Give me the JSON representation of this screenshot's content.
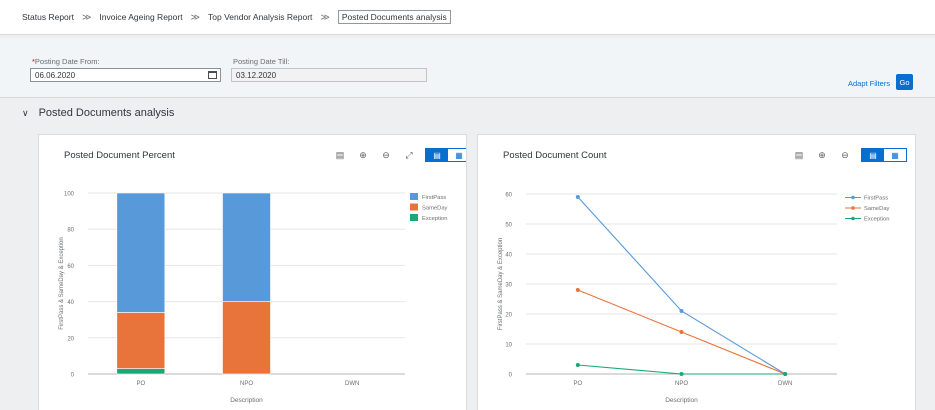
{
  "breadcrumbs": [
    {
      "label": "Status Report"
    },
    {
      "label": "Invoice Ageing Report"
    },
    {
      "label": "Top Vendor Analysis Report"
    },
    {
      "label": "Posted Documents analysis"
    }
  ],
  "breadcrumb_separator": "≫",
  "filters": {
    "from_required_mark": "*",
    "from_label": "Posting Date From:",
    "from_value": "06.06.2020",
    "till_label": "Posting Date Till:",
    "till_value": "03.12.2020",
    "adapt_label": "Adapt Filters",
    "go_label": "Go"
  },
  "section": {
    "chevron": "∨",
    "title": "Posted Documents analysis"
  },
  "panels": {
    "percent_title": "Posted Document Percent",
    "count_title": "Posted Document Count"
  },
  "colors": {
    "firstpass": "#5899da",
    "sameday": "#e8743b",
    "exception": "#19a979",
    "accent": "#0a6ed1"
  },
  "chart_data": [
    {
      "type": "bar",
      "stacked": true,
      "title": "Posted Document Percent",
      "categories": [
        "PO",
        "NPO",
        "DWN"
      ],
      "series": [
        {
          "name": "Exception",
          "values": [
            3,
            0,
            0
          ]
        },
        {
          "name": "SameDay",
          "values": [
            31,
            40,
            0
          ]
        },
        {
          "name": "FirstPass",
          "values": [
            66,
            60,
            0
          ]
        }
      ],
      "legend": [
        "FirstPass",
        "SameDay",
        "Exception"
      ],
      "xlabel": "Description",
      "ylabel": "FirstPass & SameDay & Exception",
      "ylim": [
        0,
        100
      ],
      "yticks": [
        0,
        20,
        40,
        60,
        80,
        100
      ],
      "legend_position": "right",
      "grid": true
    },
    {
      "type": "line",
      "title": "Posted Document Count",
      "categories": [
        "PO",
        "NPO",
        "DWN"
      ],
      "series": [
        {
          "name": "FirstPass",
          "values": [
            59,
            21,
            0
          ]
        },
        {
          "name": "SameDay",
          "values": [
            28,
            14,
            0
          ]
        },
        {
          "name": "Exception",
          "values": [
            3,
            0,
            0
          ]
        }
      ],
      "legend": [
        "FirstPass",
        "SameDay",
        "Exception"
      ],
      "xlabel": "Description",
      "ylabel": "FirstPass & SameDay & Exception",
      "ylim": [
        0,
        60
      ],
      "yticks": [
        0,
        10,
        20,
        30,
        40,
        50,
        60
      ],
      "legend_position": "right",
      "grid": true
    }
  ]
}
